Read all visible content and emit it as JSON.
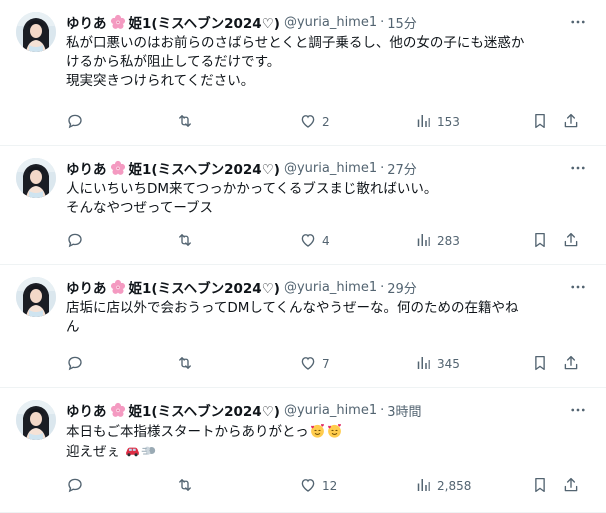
{
  "tweets": [
    {
      "name": "ゆりあ",
      "name_suffix": "姫1(ミスヘブン2024♡)",
      "handle": "@yuria_hime1",
      "dot": "·",
      "time": "15分",
      "lines": [
        "私が口悪いのはお前らのさばらせとくと調子乗るし、他の女の子にも迷惑か",
        "けるから私が阻止してるだけです。",
        "現実突きつけられてください。"
      ],
      "replies": "",
      "retweets": "",
      "likes": "2",
      "views": "153"
    },
    {
      "name": "ゆりあ",
      "name_suffix": "姫1(ミスヘブン2024♡)",
      "handle": "@yuria_hime1",
      "dot": "·",
      "time": "27分",
      "lines": [
        "人にいちいちDM来てつっかかってくるブスまじ散ればいい。",
        "そんなやつぜってーブス"
      ],
      "replies": "",
      "retweets": "",
      "likes": "4",
      "views": "283"
    },
    {
      "name": "ゆりあ",
      "name_suffix": "姫1(ミスヘブン2024♡)",
      "handle": "@yuria_hime1",
      "dot": "·",
      "time": "29分",
      "lines": [
        "店垢に店以外で会おうってDMしてくんなやうぜーな。何のための在籍やね",
        "ん"
      ],
      "replies": "",
      "retweets": "",
      "likes": "7",
      "views": "345"
    },
    {
      "name": "ゆりあ",
      "name_suffix": "姫1(ミスヘブン2024♡)",
      "handle": "@yuria_hime1",
      "dot": "·",
      "time": "3時間",
      "lines": [
        "本日もご本指様スタートからありがとっ",
        "迎えぜぇ"
      ],
      "replies": "",
      "retweets": "",
      "likes": "12",
      "views": "2,858"
    }
  ],
  "icons": {
    "more": "more-horizontal-icon",
    "reply": "reply-icon",
    "retweet": "retweet-icon",
    "like": "heart-icon",
    "views": "views-chart-icon",
    "bookmark": "bookmark-icon",
    "share": "share-icon",
    "flower": "cherry-blossom-icon"
  },
  "colors": {
    "text": "#0f1419",
    "secondary": "#536471",
    "divider": "#eff3f4",
    "flower": "#f49ac1"
  }
}
